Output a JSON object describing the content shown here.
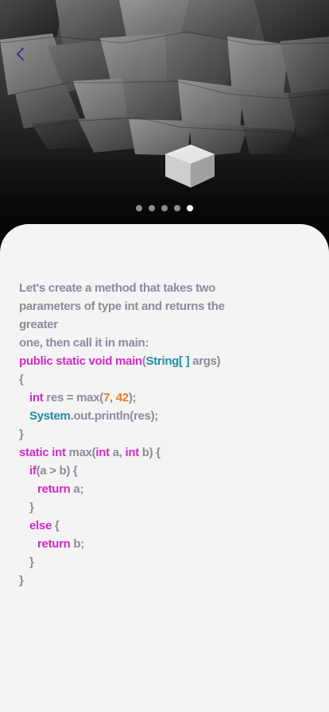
{
  "header": {
    "back_icon": "chevron-left-icon",
    "accent_color": "#4b2f7e"
  },
  "pagination": {
    "total": 5,
    "active_index": 5
  },
  "lesson": {
    "intro_lines": [
      "Let's create a method that takes two",
      "parameters of type int and returns the greater",
      "one, then call it in main:"
    ],
    "code": [
      {
        "indent": 0,
        "segments": [
          {
            "text": "public static void main",
            "style": "kw"
          },
          {
            "text": "(",
            "style": "plain"
          },
          {
            "text": "String[ ]",
            "style": "type"
          },
          {
            "text": " args)",
            "style": "plain"
          }
        ]
      },
      {
        "indent": 0,
        "segments": [
          {
            "text": "{",
            "style": "plain"
          }
        ]
      },
      {
        "indent": 1,
        "segments": [
          {
            "text": "int",
            "style": "kw"
          },
          {
            "text": " res = max(",
            "style": "plain"
          },
          {
            "text": "7",
            "style": "num"
          },
          {
            "text": ", ",
            "style": "plain"
          },
          {
            "text": "42",
            "style": "num"
          },
          {
            "text": ");",
            "style": "plain"
          }
        ]
      },
      {
        "indent": 1,
        "segments": [
          {
            "text": "System",
            "style": "type"
          },
          {
            "text": ".out.println(res);",
            "style": "plain"
          }
        ]
      },
      {
        "indent": 0,
        "segments": [
          {
            "text": "}",
            "style": "plain"
          }
        ]
      },
      {
        "indent": 0,
        "segments": [
          {
            "text": "static int",
            "style": "kw"
          },
          {
            "text": " max(",
            "style": "plain"
          },
          {
            "text": "int",
            "style": "kw"
          },
          {
            "text": " a, ",
            "style": "plain"
          },
          {
            "text": "int",
            "style": "kw"
          },
          {
            "text": " b) {",
            "style": "plain"
          }
        ]
      },
      {
        "indent": 1,
        "segments": [
          {
            "text": "if",
            "style": "kw"
          },
          {
            "text": "(a > b) {",
            "style": "plain"
          }
        ]
      },
      {
        "indent": 2,
        "segments": [
          {
            "text": "return",
            "style": "kw"
          },
          {
            "text": " a;",
            "style": "plain"
          }
        ]
      },
      {
        "indent": 1,
        "segments": [
          {
            "text": "}",
            "style": "plain"
          }
        ]
      },
      {
        "indent": 1,
        "segments": [
          {
            "text": "else",
            "style": "kw"
          },
          {
            "text": " {",
            "style": "plain"
          }
        ]
      },
      {
        "indent": 2,
        "segments": [
          {
            "text": "return",
            "style": "kw"
          },
          {
            "text": " b;",
            "style": "plain"
          }
        ]
      },
      {
        "indent": 1,
        "segments": [
          {
            "text": "}",
            "style": "plain"
          }
        ]
      },
      {
        "indent": 0,
        "segments": [
          {
            "text": "}",
            "style": "plain"
          }
        ]
      }
    ]
  }
}
